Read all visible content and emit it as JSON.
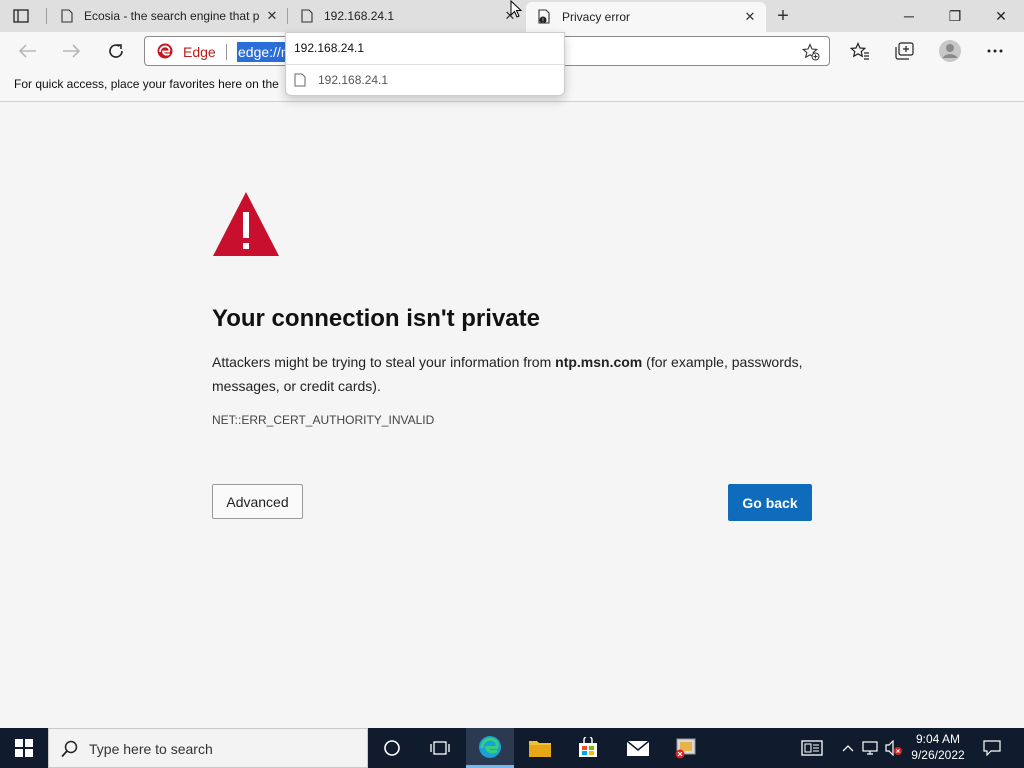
{
  "tabs": [
    {
      "title": "Ecosia - the search engine that p",
      "favicon": "page-icon"
    },
    {
      "title": "192.168.24.1",
      "favicon": "page-icon"
    },
    {
      "title": "Privacy error",
      "favicon": "warning-page-icon"
    }
  ],
  "window_controls": {
    "minimize": "─",
    "restore": "❐",
    "close": "✕"
  },
  "address_bar": {
    "site_label": "Edge",
    "url_selected": "edge://n"
  },
  "favorites_bar": {
    "hint": "For quick access, place your favorites here on the"
  },
  "dropdown": {
    "typed": "192.168.24.1",
    "suggestion": "192.168.24.1"
  },
  "error_page": {
    "heading": "Your connection isn't private",
    "desc_before": "Attackers might be trying to steal your information from ",
    "desc_host": "ntp.msn.com",
    "desc_after": " (for example, passwords, messages, or credit cards).",
    "error_code": "NET::ERR_CERT_AUTHORITY_INVALID",
    "advanced_label": "Advanced",
    "go_back_label": "Go back",
    "accent": "#0f6cbd",
    "warning_color": "#c8102e"
  },
  "taskbar": {
    "search_placeholder": "Type here to search",
    "time": "9:04 AM",
    "date": "9/26/2022"
  }
}
